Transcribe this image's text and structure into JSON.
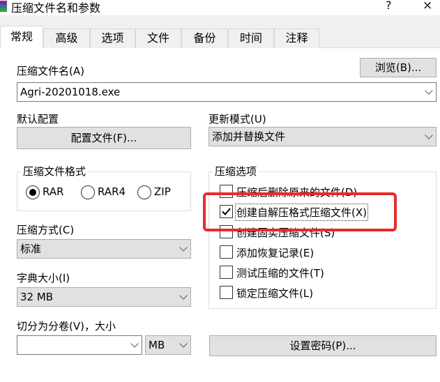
{
  "window": {
    "title": "压缩文件名和参数",
    "help_label": "?",
    "close_label": "×"
  },
  "tabs": [
    {
      "label": "常规",
      "active": true
    },
    {
      "label": "高级"
    },
    {
      "label": "选项"
    },
    {
      "label": "文件"
    },
    {
      "label": "备份"
    },
    {
      "label": "时间"
    },
    {
      "label": "注释"
    }
  ],
  "archive_name": {
    "label": "压缩文件名(A)",
    "value": "Agri-20201018.exe",
    "browse_label": "浏览(B)..."
  },
  "profile": {
    "label": "默认配置",
    "button_label": "配置文件(F)..."
  },
  "update_mode": {
    "label": "更新模式(U)",
    "value": "添加并替换文件"
  },
  "format": {
    "label": "压缩文件格式",
    "options": [
      {
        "label": "RAR",
        "selected": true
      },
      {
        "label": "RAR4",
        "selected": false
      },
      {
        "label": "ZIP",
        "selected": false
      }
    ]
  },
  "method": {
    "label": "压缩方式(C)",
    "value": "标准"
  },
  "dictionary": {
    "label": "字典大小(I)",
    "value": "32 MB"
  },
  "split": {
    "label": "切分为分卷(V)，大小",
    "value": "",
    "unit": "MB"
  },
  "options": {
    "label": "压缩选项",
    "items": [
      {
        "label": "压缩后删除原来的文件(D)",
        "checked": false
      },
      {
        "label": "创建自解压格式压缩文件(X)",
        "checked": true
      },
      {
        "label": "创建固实压缩文件(S)",
        "checked": false
      },
      {
        "label": "添加恢复记录(E)",
        "checked": false
      },
      {
        "label": "测试压缩的文件(T)",
        "checked": false
      },
      {
        "label": "锁定压缩文件(L)",
        "checked": false
      }
    ]
  },
  "password_button": {
    "label": "设置密码(P)..."
  },
  "colors": {
    "annotation_red": "#e82a2a",
    "panel_bg": "#ffffff",
    "dialog_bg": "#f0f0f0"
  }
}
